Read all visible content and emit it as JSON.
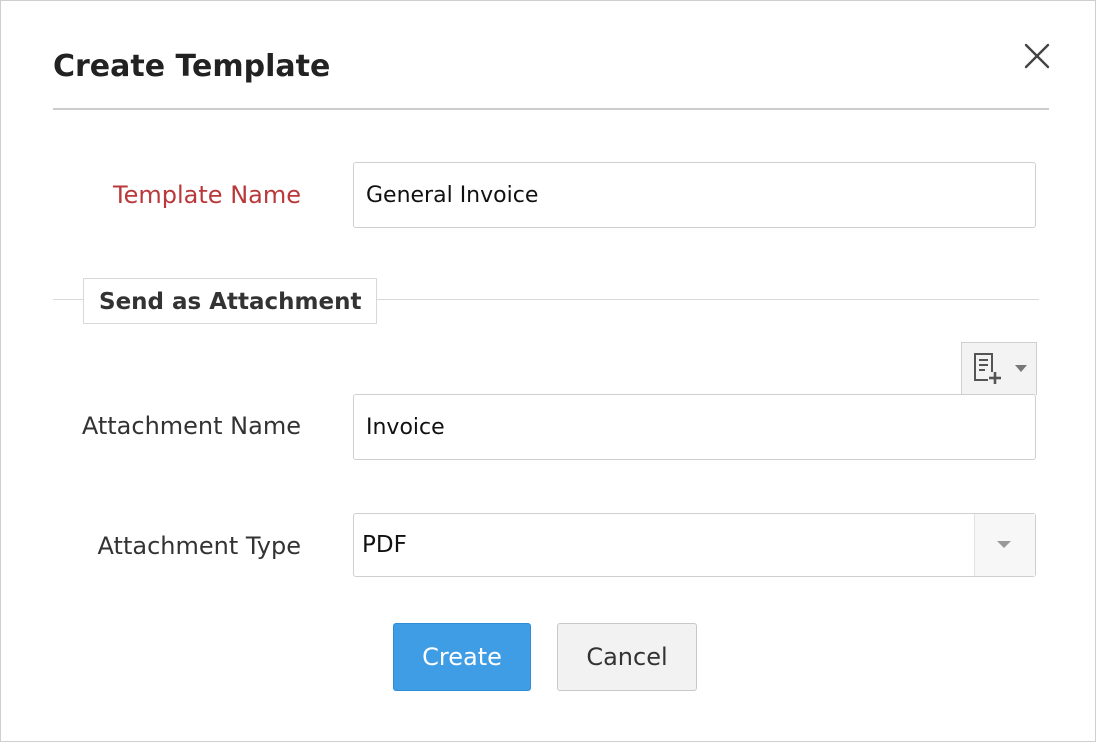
{
  "dialog": {
    "title": "Create Template",
    "close_icon": "close-icon"
  },
  "form": {
    "template_name": {
      "label": "Template Name",
      "value": "General Invoice",
      "required": true
    },
    "section": {
      "legend": "Send as Attachment"
    },
    "insert_placeholder_icon": "document-add-icon",
    "attachment_name": {
      "label": "Attachment Name",
      "value": "Invoice"
    },
    "attachment_type": {
      "label": "Attachment Type",
      "selected": "PDF"
    }
  },
  "actions": {
    "create_label": "Create",
    "cancel_label": "Cancel"
  },
  "colors": {
    "required_label": "#b9393b",
    "primary_button": "#3f9de6",
    "secondary_button": "#f2f2f2"
  }
}
